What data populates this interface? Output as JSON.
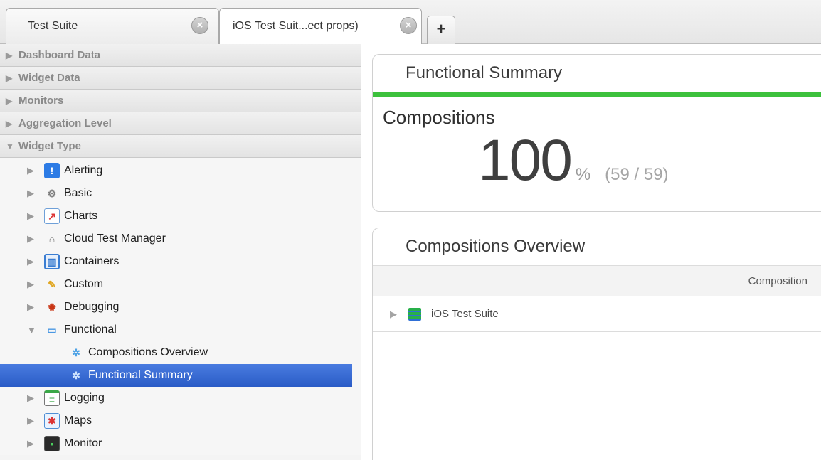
{
  "tabs": [
    {
      "label": "Test Suite",
      "close": "×"
    },
    {
      "label": "iOS Test Suit...ect props)",
      "close": "×"
    }
  ],
  "add_tab_label": "+",
  "sidebar": {
    "sections": [
      {
        "label": "Dashboard Data",
        "arrow": "▶"
      },
      {
        "label": "Widget Data",
        "arrow": "▶"
      },
      {
        "label": "Monitors",
        "arrow": "▶"
      },
      {
        "label": "Aggregation Level",
        "arrow": "▶"
      },
      {
        "label": "Widget Type",
        "arrow": "▼"
      }
    ],
    "tree": [
      {
        "label": "Alerting",
        "icon": "alert-icon",
        "glyph": "!",
        "arrow": "▶"
      },
      {
        "label": "Basic",
        "icon": "basic-icon",
        "glyph": "⚙",
        "arrow": "▶"
      },
      {
        "label": "Charts",
        "icon": "chart-icon",
        "glyph": "↗",
        "arrow": "▶"
      },
      {
        "label": "Cloud Test Manager",
        "icon": "cloud-manager-icon",
        "glyph": "⌂",
        "arrow": "▶"
      },
      {
        "label": "Containers",
        "icon": "container-icon",
        "glyph": "▥",
        "arrow": "▶"
      },
      {
        "label": "Custom",
        "icon": "wrench-icon",
        "glyph": "✎",
        "arrow": "▶"
      },
      {
        "label": "Debugging",
        "icon": "bug-icon",
        "glyph": "✹",
        "arrow": "▶"
      },
      {
        "label": "Functional",
        "icon": "folder-icon",
        "glyph": "▭",
        "arrow": "▼"
      },
      {
        "label": "Compositions Overview",
        "icon": "gear-icon",
        "glyph": "✲"
      },
      {
        "label": "Functional Summary",
        "icon": "gear-icon",
        "glyph": "✲"
      },
      {
        "label": "Logging",
        "icon": "logging-icon",
        "glyph": "≡",
        "arrow": "▶"
      },
      {
        "label": "Maps",
        "icon": "map-icon",
        "glyph": "✱",
        "arrow": "▶"
      },
      {
        "label": "Monitor",
        "icon": "monitor-icon",
        "glyph": "▪",
        "arrow": "▶"
      }
    ]
  },
  "functional_summary": {
    "title": "Functional Summary",
    "label": "Compositions",
    "percent": "100",
    "percent_sign": "%",
    "ratio": "(59 / 59)"
  },
  "compositions_overview": {
    "title": "Compositions Overview",
    "column_header": "Composition",
    "rows": [
      {
        "name": "iOS Test Suite",
        "arrow": "▶"
      }
    ]
  },
  "colors": {
    "accent_green": "#3cc13c",
    "selection_blue": "#2a5bc6"
  }
}
